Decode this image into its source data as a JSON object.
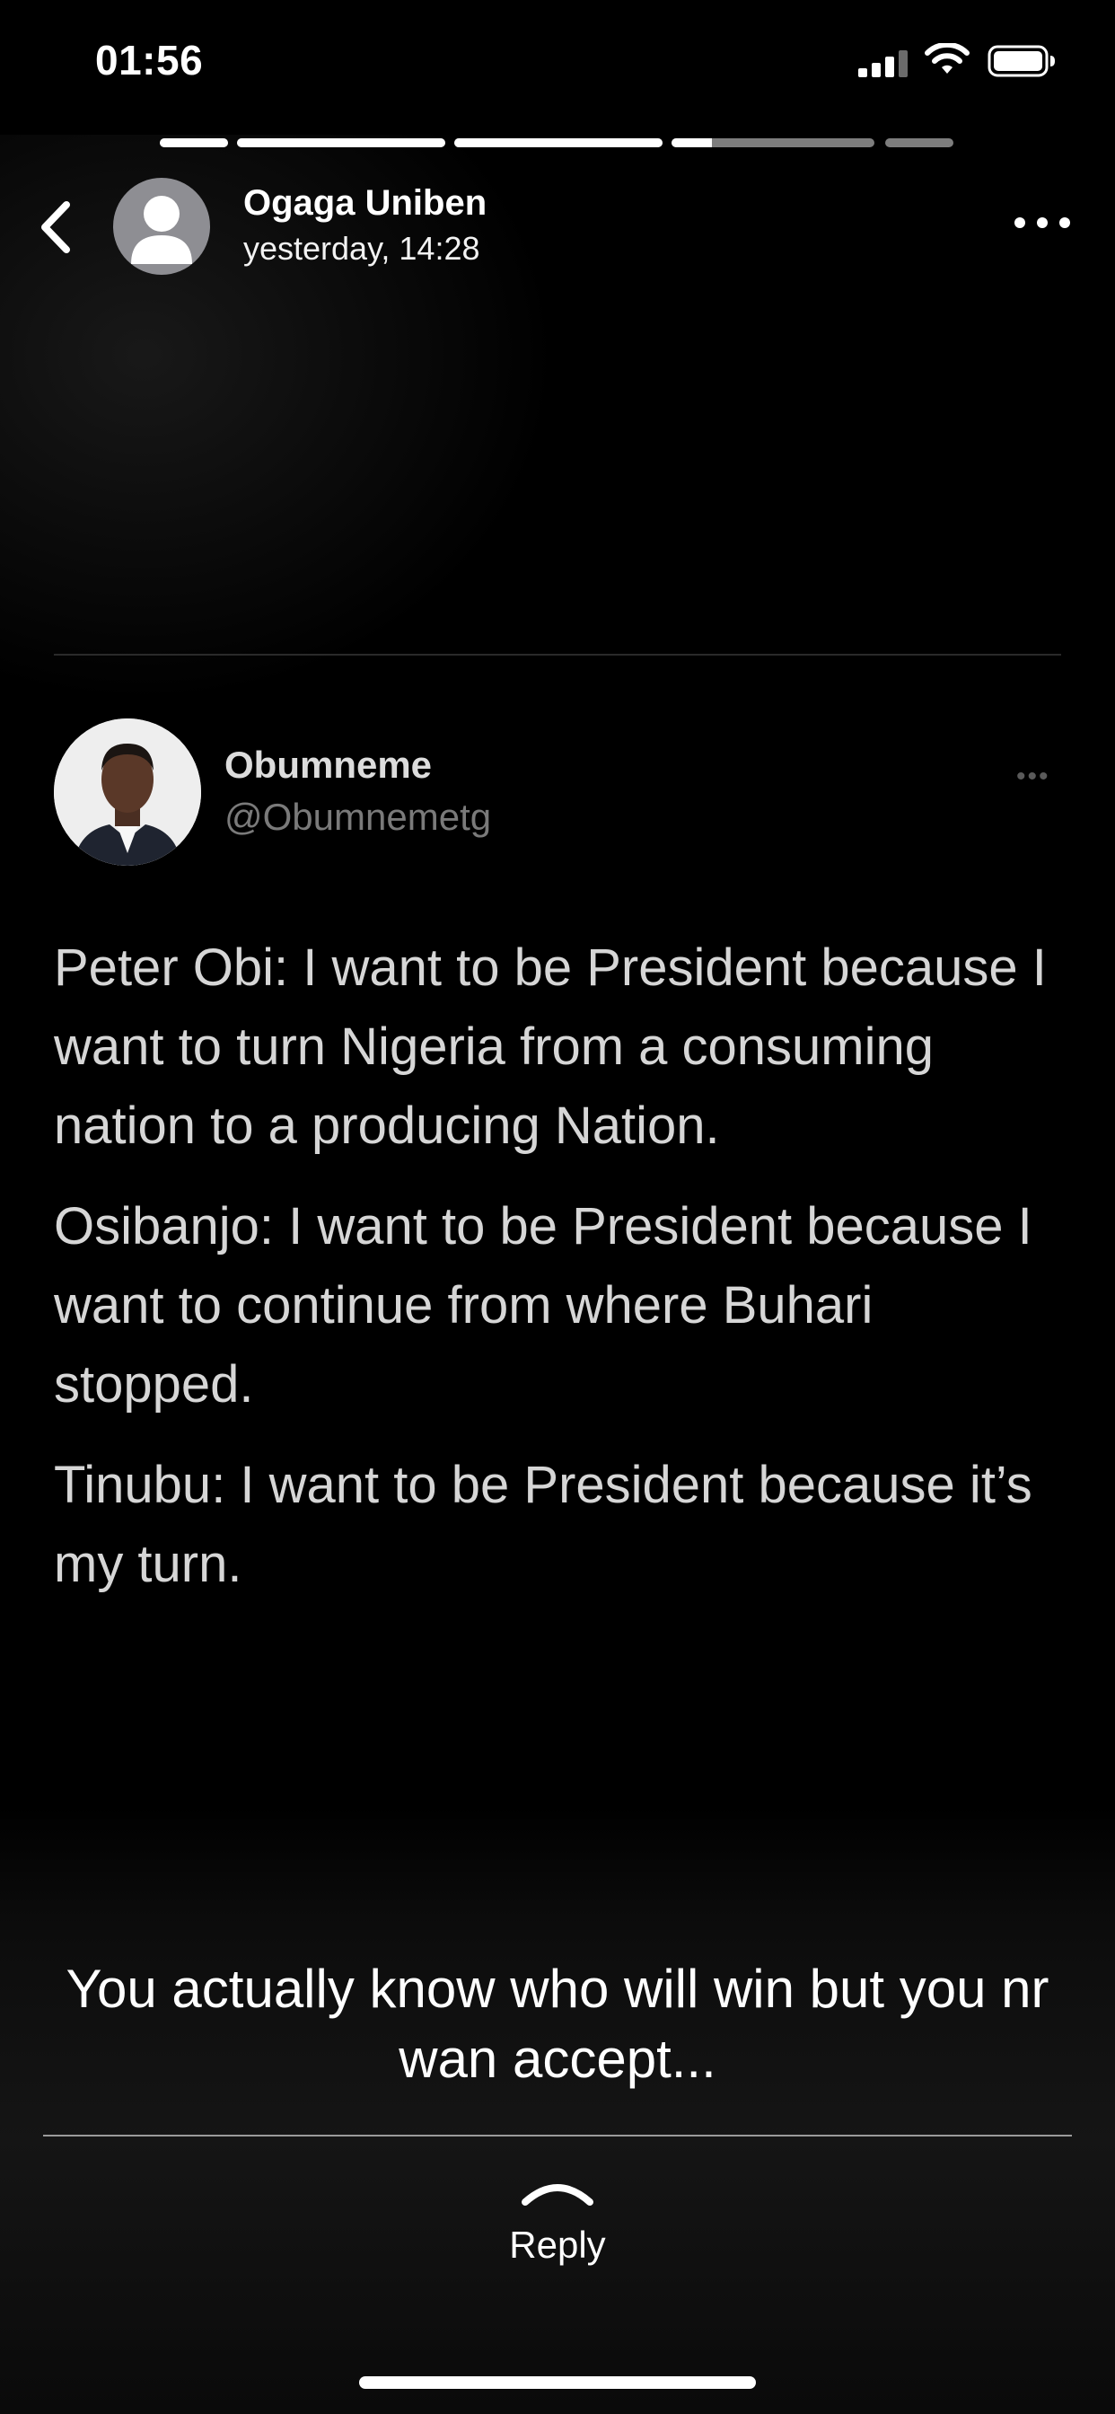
{
  "status_bar": {
    "time": "01:56",
    "icons": [
      "cellular-signal-icon",
      "wifi-icon",
      "battery-icon"
    ]
  },
  "story": {
    "progress": [
      {
        "segment": 1,
        "fill": 1.0
      },
      {
        "segment": 2,
        "fill": 1.0
      },
      {
        "segment": 3,
        "fill": 1.0
      },
      {
        "segment": 4,
        "fill": 0.2
      },
      {
        "segment": 5,
        "fill": 0.0
      }
    ]
  },
  "header": {
    "back_icon": "chevron-left-icon",
    "contact_name": "Ogaga Uniben",
    "posted_time": "yesterday, 14:28",
    "more_icon": "ellipsis-icon"
  },
  "tweet": {
    "display_name": "Obumneme",
    "handle": "@Obumnemetg",
    "more_label": "•••",
    "paragraphs": [
      "Peter Obi: I want to be President because I want to turn Nigeria from a consuming nation to a producing Nation.",
      "Osibanjo: I want to be President because I want to continue from where Buhari stopped.",
      "Tinubu: I want to be President because it’s my turn."
    ]
  },
  "caption": "You actually know who will win but you nr wan accept...",
  "reply": {
    "label": "Reply",
    "icon": "chevron-up-icon"
  },
  "colors": {
    "background": "#000000",
    "text": "#ffffff",
    "tweet_text": "#d6d6d6",
    "handle": "#7a7a7a",
    "progress_track": "#7d7d7d"
  }
}
